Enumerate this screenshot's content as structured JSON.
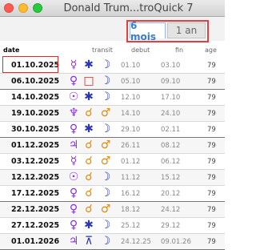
{
  "window": {
    "title": "Donald Trum...troQuick 7"
  },
  "tabs": [
    {
      "label": "6 mois",
      "active": true
    },
    {
      "label": "1 an",
      "active": false
    }
  ],
  "columns": {
    "date": "date",
    "transit": "transit",
    "debut": "debut",
    "fin": "fin",
    "age": "age"
  },
  "colors": {
    "violet": "#8a2be2",
    "blue": "#2a35b0",
    "orange": "#e68a00",
    "red": "#e02020"
  },
  "rows": [
    {
      "date": "01.10.2025",
      "p1": "☿",
      "p1_color": "#8a2be2",
      "aspect": "✱",
      "aspect_color": "#2a35b0",
      "p2": "☽",
      "debut": "01.10",
      "fin": "03.10",
      "age": "79"
    },
    {
      "date": "06.10.2025",
      "p1": "♀",
      "p1_color": "#8a2be2",
      "aspect": "□",
      "aspect_color": "#e02020",
      "p2": "☽",
      "debut": "05.10",
      "fin": "09.10",
      "age": "79"
    },
    {
      "date": "14.10.2025",
      "p1": "☉",
      "p1_color": "#8a2be2",
      "aspect": "✱",
      "aspect_color": "#2a35b0",
      "p2": "☽",
      "debut": "12.10",
      "fin": "17.10",
      "age": "79"
    },
    {
      "date": "19.10.2025",
      "p1": "♆",
      "p1_color": "#8a2be2",
      "aspect": "☌",
      "aspect_color": "#e68a00",
      "p2": "♂",
      "debut": "14.10",
      "fin": "24.10",
      "age": "79"
    },
    {
      "date": "30.10.2025",
      "p1": "♀",
      "p1_color": "#8a2be2",
      "aspect": "✱",
      "aspect_color": "#2a35b0",
      "p2": "☽",
      "debut": "29.10",
      "fin": "02.11",
      "age": "79"
    },
    {
      "date": "01.12.2025",
      "p1": "♃",
      "p1_color": "#8a2be2",
      "aspect": "☌",
      "aspect_color": "#e68a00",
      "p2": "♂",
      "debut": "26.11",
      "fin": "08.12",
      "age": "79"
    },
    {
      "date": "03.12.2025",
      "p1": "☿",
      "p1_color": "#8a2be2",
      "aspect": "☌",
      "aspect_color": "#e68a00",
      "p2": "♂",
      "debut": "01.12",
      "fin": "06.12",
      "age": "79"
    },
    {
      "date": "12.12.2025",
      "p1": "☉",
      "p1_color": "#8a2be2",
      "aspect": "☌",
      "aspect_color": "#e68a00",
      "p2": "☽",
      "debut": "11.12",
      "fin": "15.12",
      "age": "79"
    },
    {
      "date": "17.12.2025",
      "p1": "♀",
      "p1_color": "#8a2be2",
      "aspect": "☌",
      "aspect_color": "#e68a00",
      "p2": "☽",
      "debut": "16.12",
      "fin": "20.12",
      "age": "79"
    },
    {
      "date": "22.12.2025",
      "p1": "♀",
      "p1_color": "#8a2be2",
      "aspect": "☌",
      "aspect_color": "#e68a00",
      "p2": "♂",
      "debut": "18.12",
      "fin": "24.12",
      "age": "79"
    },
    {
      "date": "27.12.2025",
      "p1": "♀",
      "p1_color": "#8a2be2",
      "aspect": "✱",
      "aspect_color": "#2a35b0",
      "p2": "☽",
      "debut": "25.12",
      "fin": "29.12",
      "age": "79"
    },
    {
      "date": "01.01.2026",
      "p1": "♃",
      "p1_color": "#8a2be2",
      "aspect": "⊼",
      "aspect_color": "#2a35b0",
      "p2": "☽",
      "debut": "24.12.25",
      "fin": "09.01.26",
      "age": "79"
    }
  ]
}
